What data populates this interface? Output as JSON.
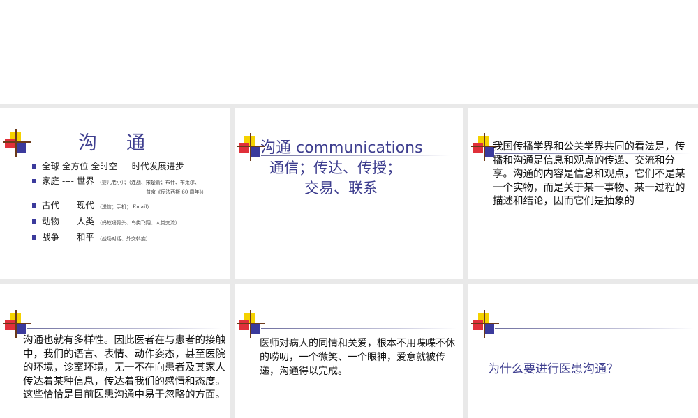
{
  "slide1": {
    "title": "沟通",
    "items": [
      {
        "main": "全球  全方位  全时空 --- 时代发展进步",
        "note": ""
      },
      {
        "main": "家庭 ---- 世界",
        "note": "（婴儿老小）；（连战、宋楚俞；布什、布莱尔、",
        "sub": "普京《反法西斯  60 周年》）"
      },
      {
        "main": "古代 ---- 现代",
        "note": "（送信；手机； Email）"
      },
      {
        "main": "动物 ---- 人类",
        "note": "（蚂蚁嗜骨头、鸟类飞翔、人类交流）"
      },
      {
        "main": "战争 ---- 和平",
        "note": "（战场对话、外交斡旋）"
      }
    ]
  },
  "slide2": {
    "line1": "沟通 communications",
    "line2": "通信；传达、传授；",
    "line3": "交易、联系"
  },
  "slide3": {
    "body": "我国传播学界和公关学界共同的看法是，传播和沟通是信息和观点的传递、交流和分享。沟通的内容是信息和观点，它们不是某一个实物，而是关于某一事物、某一过程的描述和结论，因而它们是抽象的"
  },
  "slide4": {
    "body": "沟通也就有多样性。因此医者在与患者的接触中，我们的语言、表情、动作姿态，甚至医院的环境，诊室环境，无一不在向患者及其家人传达着某种信息，传达着我们的感情和态度。这些恰恰是目前医患沟通中易于忽略的方面。"
  },
  "slide5": {
    "body": "医师对病人的同情和关爱，根本不用喋喋不休的唠叨，一个微笑、一个眼神，爱意就被传递，沟通得以完成。"
  },
  "slide6": {
    "question": "为什么要进行医患沟通？"
  },
  "colors": {
    "accent": "#3e3e8f",
    "logo_yellow": "#f5d200",
    "logo_red": "#e0303a",
    "logo_blue": "#3b3a9c"
  }
}
